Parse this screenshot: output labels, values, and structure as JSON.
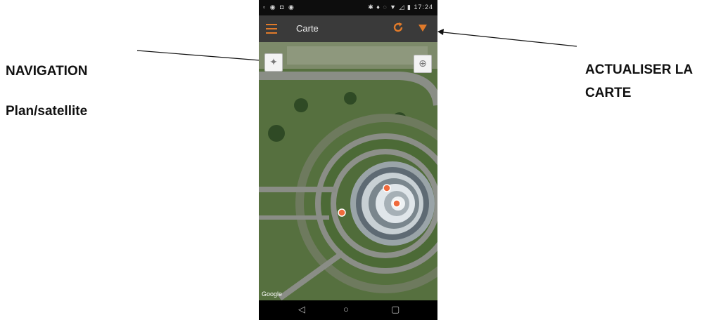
{
  "annotations": {
    "navigation": "NAVIGATION",
    "plan_satellite": "Plan/satellite",
    "refresh_line1": "ACTUALISER LA",
    "refresh_line2": "CARTE"
  },
  "status_bar": {
    "left_icons": "▫ ◉ ◘ ◉",
    "right_icons": "✱ ♦ ◌ ▼ ◿ ▮ 17:24"
  },
  "app_bar": {
    "title": "Carte",
    "menu_icon": "hamburger-icon",
    "refresh_icon": "refresh-icon",
    "filter_icon": "filter-icon",
    "accent_color": "#e07a2a"
  },
  "map": {
    "attribution": "Google",
    "nav_button_icon": "compass-icon",
    "layer_button_icon": "crosshair-icon"
  },
  "nav_bar": {
    "back": "◁",
    "home": "○",
    "recents": "▢"
  }
}
